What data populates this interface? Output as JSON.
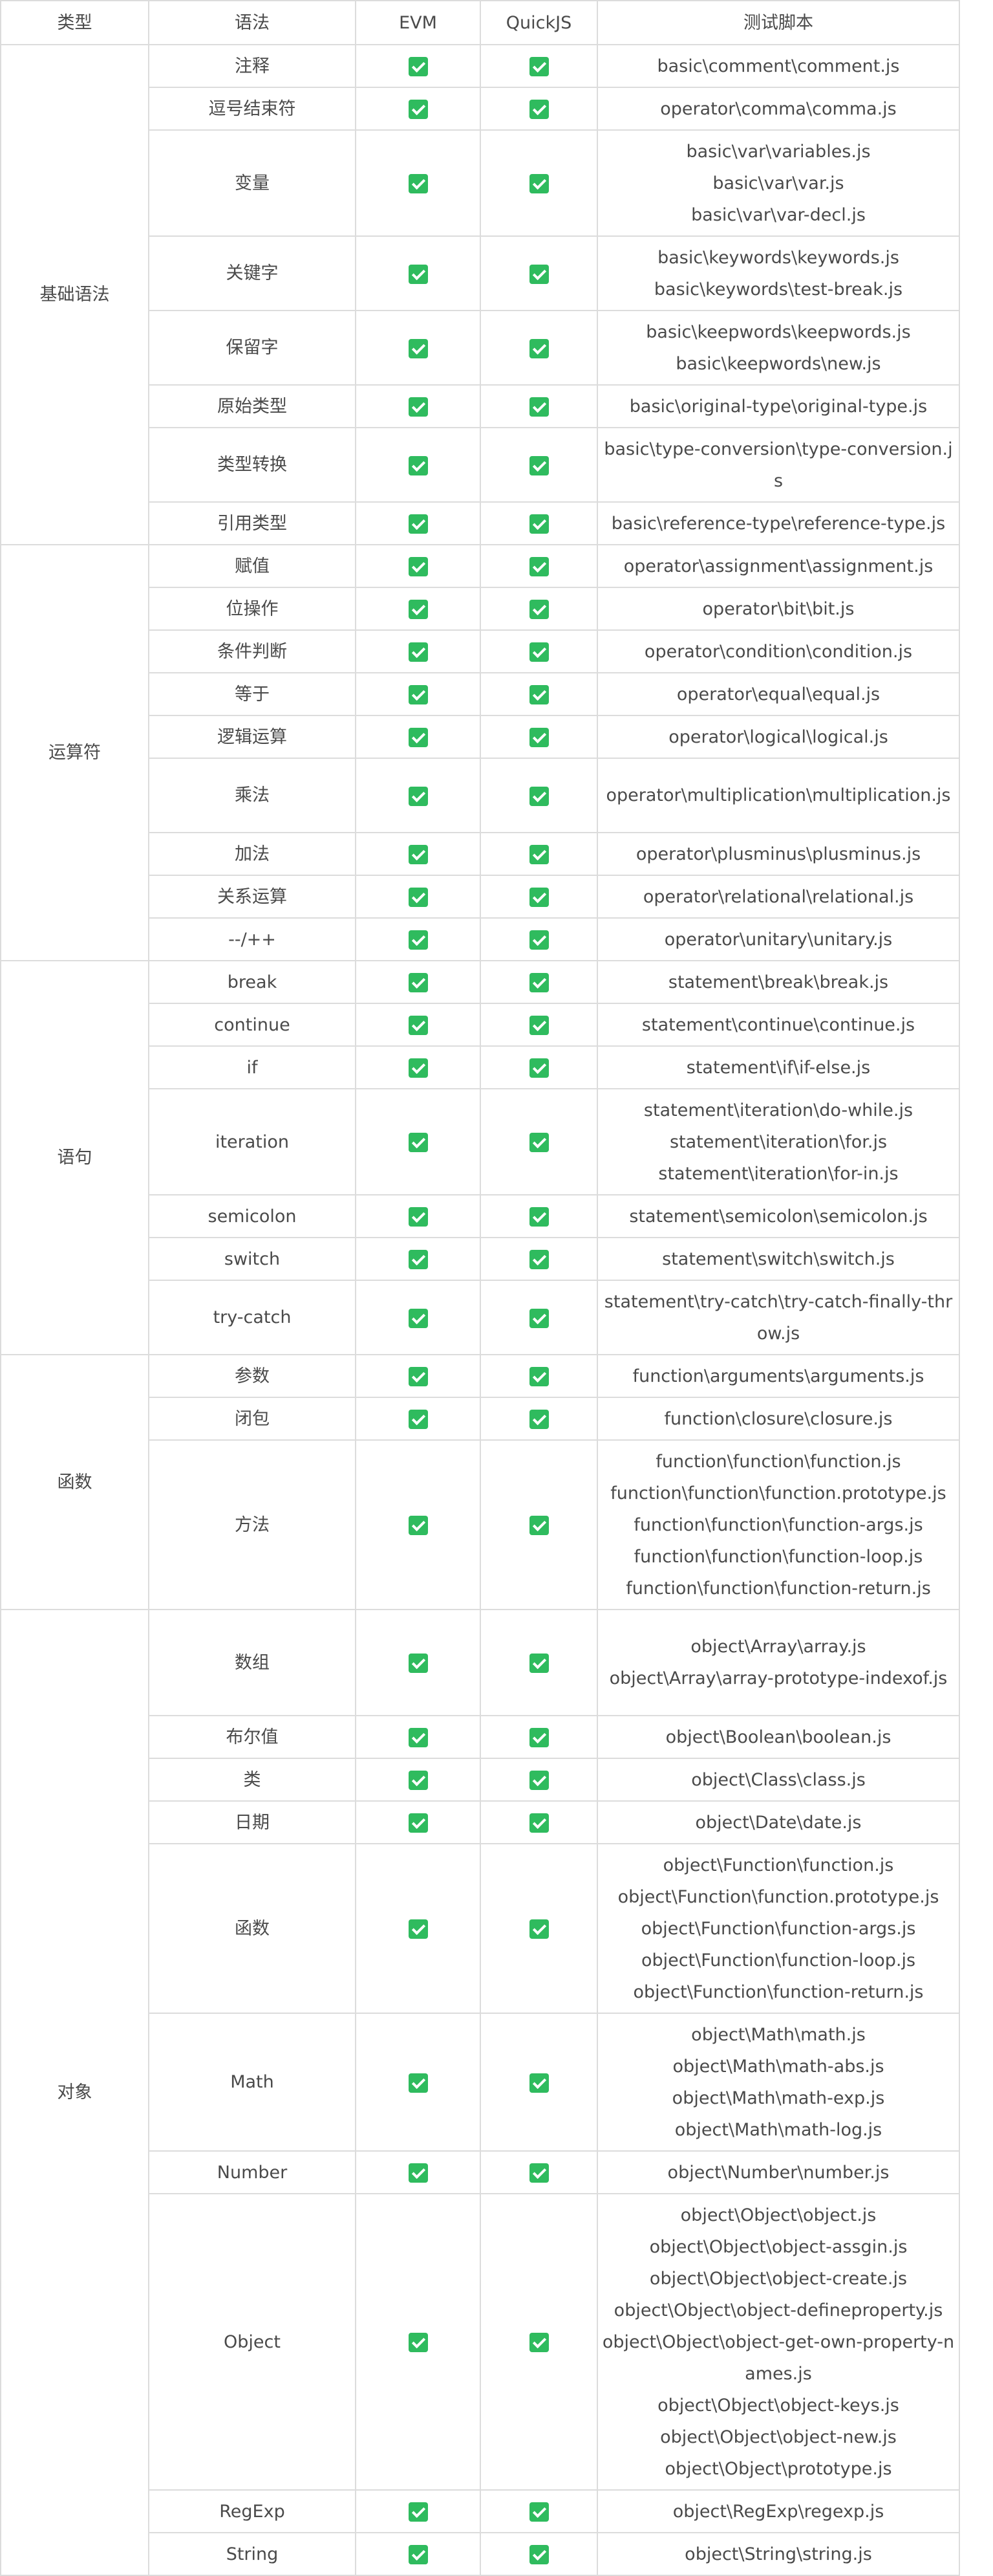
{
  "headers": {
    "type": "类型",
    "syntax": "语法",
    "evm": "EVM",
    "quickjs": "QuickJS",
    "script": "测试脚本"
  },
  "colors": {
    "check": "#2fbb5e",
    "border": "#dcdcdc",
    "text": "#4a4a4a"
  },
  "status_icon": "green-checkbox-icon",
  "groups": [
    {
      "category": "基础语法",
      "rows": [
        {
          "syntax": "注释",
          "evm": true,
          "quickjs": true,
          "scripts": [
            "basic\\comment\\comment.js"
          ]
        },
        {
          "syntax": "逗号结束符",
          "evm": true,
          "quickjs": true,
          "scripts": [
            "operator\\comma\\comma.js"
          ]
        },
        {
          "syntax": "变量",
          "evm": true,
          "quickjs": true,
          "scripts": [
            "basic\\var\\variables.js",
            "basic\\var\\var.js",
            "basic\\var\\var-decl.js"
          ]
        },
        {
          "syntax": "关键字",
          "evm": true,
          "quickjs": true,
          "scripts": [
            "basic\\keywords\\keywords.js",
            "basic\\keywords\\test-break.js"
          ]
        },
        {
          "syntax": "保留字",
          "evm": true,
          "quickjs": true,
          "scripts": [
            "basic\\keepwords\\keepwords.js",
            "basic\\keepwords\\new.js"
          ]
        },
        {
          "syntax": "原始类型",
          "evm": true,
          "quickjs": true,
          "scripts": [
            "basic\\original-type\\original-type.js"
          ]
        },
        {
          "syntax": "类型转换",
          "evm": true,
          "quickjs": true,
          "scripts": [
            "basic\\type-conversion\\type-conversion.js"
          ]
        },
        {
          "syntax": "引用类型",
          "evm": true,
          "quickjs": true,
          "scripts": [
            "basic\\reference-type\\reference-type.js"
          ]
        }
      ]
    },
    {
      "category": "运算符",
      "rows": [
        {
          "syntax": "赋值",
          "evm": true,
          "quickjs": true,
          "scripts": [
            "operator\\assignment\\assignment.js"
          ]
        },
        {
          "syntax": "位操作",
          "evm": true,
          "quickjs": true,
          "scripts": [
            "operator\\bit\\bit.js"
          ]
        },
        {
          "syntax": "条件判断",
          "evm": true,
          "quickjs": true,
          "scripts": [
            "operator\\condition\\condition.js"
          ]
        },
        {
          "syntax": "等于",
          "evm": true,
          "quickjs": true,
          "scripts": [
            "operator\\equal\\equal.js"
          ]
        },
        {
          "syntax": "逻辑运算",
          "evm": true,
          "quickjs": true,
          "scripts": [
            "operator\\logical\\logical.js"
          ]
        },
        {
          "syntax": "乘法",
          "evm": true,
          "quickjs": true,
          "scripts": [
            "operator\\multiplication\\multiplication.js"
          ]
        },
        {
          "syntax": "加法",
          "evm": true,
          "quickjs": true,
          "scripts": [
            "operator\\plusminus\\plusminus.js"
          ]
        },
        {
          "syntax": "关系运算",
          "evm": true,
          "quickjs": true,
          "scripts": [
            "operator\\relational\\relational.js"
          ]
        },
        {
          "syntax": "--/++",
          "evm": true,
          "quickjs": true,
          "scripts": [
            "operator\\unitary\\unitary.js"
          ]
        }
      ]
    },
    {
      "category": "语句",
      "rows": [
        {
          "syntax": "break",
          "evm": true,
          "quickjs": true,
          "scripts": [
            "statement\\break\\break.js"
          ]
        },
        {
          "syntax": "continue",
          "evm": true,
          "quickjs": true,
          "scripts": [
            "statement\\continue\\continue.js"
          ]
        },
        {
          "syntax": "if",
          "evm": true,
          "quickjs": true,
          "scripts": [
            "statement\\if\\if-else.js"
          ]
        },
        {
          "syntax": "iteration",
          "evm": true,
          "quickjs": true,
          "scripts": [
            "statement\\iteration\\do-while.js",
            "statement\\iteration\\for.js",
            "statement\\iteration\\for-in.js"
          ]
        },
        {
          "syntax": "semicolon",
          "evm": true,
          "quickjs": true,
          "scripts": [
            "statement\\semicolon\\semicolon.js"
          ]
        },
        {
          "syntax": "switch",
          "evm": true,
          "quickjs": true,
          "scripts": [
            "statement\\switch\\switch.js"
          ]
        },
        {
          "syntax": "try-catch",
          "evm": true,
          "quickjs": true,
          "scripts": [
            "statement\\try-catch\\try-catch-finally-throw.js"
          ]
        }
      ]
    },
    {
      "category": "函数",
      "rows": [
        {
          "syntax": "参数",
          "evm": true,
          "quickjs": true,
          "scripts": [
            "function\\arguments\\arguments.js"
          ]
        },
        {
          "syntax": "闭包",
          "evm": true,
          "quickjs": true,
          "scripts": [
            "function\\closure\\closure.js"
          ]
        },
        {
          "syntax": "方法",
          "evm": true,
          "quickjs": true,
          "scripts": [
            "function\\function\\function.js",
            "function\\function\\function.prototype.js",
            "function\\function\\function-args.js",
            "function\\function\\function-loop.js",
            "function\\function\\function-return.js"
          ]
        }
      ]
    },
    {
      "category": "对象",
      "rows": [
        {
          "syntax": "数组",
          "evm": true,
          "quickjs": true,
          "scripts": [
            "object\\Array\\array.js",
            "object\\Array\\array-prototype-indexof.js"
          ]
        },
        {
          "syntax": "布尔值",
          "evm": true,
          "quickjs": true,
          "scripts": [
            "object\\Boolean\\boolean.js"
          ]
        },
        {
          "syntax": "类",
          "evm": true,
          "quickjs": true,
          "scripts": [
            "object\\Class\\class.js"
          ]
        },
        {
          "syntax": "日期",
          "evm": true,
          "quickjs": true,
          "scripts": [
            "object\\Date\\date.js"
          ]
        },
        {
          "syntax": "函数",
          "evm": true,
          "quickjs": true,
          "scripts": [
            "object\\Function\\function.js",
            "object\\Function\\function.prototype.js",
            "object\\Function\\function-args.js",
            "object\\Function\\function-loop.js",
            "object\\Function\\function-return.js"
          ]
        },
        {
          "syntax": "Math",
          "evm": true,
          "quickjs": true,
          "scripts": [
            "object\\Math\\math.js",
            "object\\Math\\math-abs.js",
            "object\\Math\\math-exp.js",
            "object\\Math\\math-log.js"
          ]
        },
        {
          "syntax": "Number",
          "evm": true,
          "quickjs": true,
          "scripts": [
            "object\\Number\\number.js"
          ]
        },
        {
          "syntax": "Object",
          "evm": true,
          "quickjs": true,
          "scripts": [
            "object\\Object\\object.js",
            "object\\Object\\object-assgin.js",
            "object\\Object\\object-create.js",
            "object\\Object\\object-defineproperty.js",
            "object\\Object\\object-get-own-property-names.js",
            "object\\Object\\object-keys.js",
            "object\\Object\\object-new.js",
            "object\\Object\\prototype.js"
          ]
        },
        {
          "syntax": "RegExp",
          "evm": true,
          "quickjs": true,
          "scripts": [
            "object\\RegExp\\regexp.js"
          ]
        },
        {
          "syntax": "String",
          "evm": true,
          "quickjs": true,
          "scripts": [
            "object\\String\\string.js"
          ]
        }
      ]
    }
  ]
}
